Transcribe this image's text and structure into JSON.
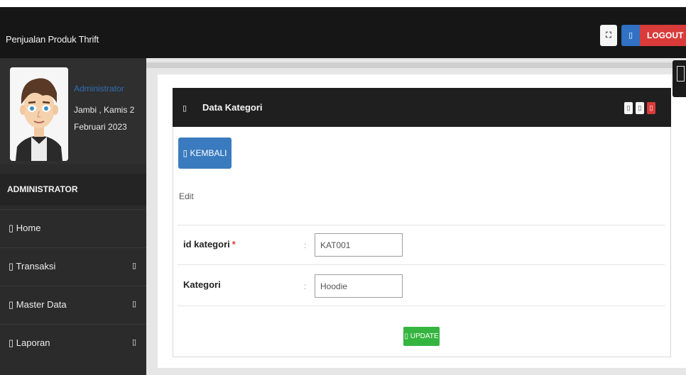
{
  "app": {
    "brand": "Penjualan Produk Thrift"
  },
  "topbar": {
    "fullscreen_icon": "expand-icon",
    "fullscreen_glyph": "⛶",
    "logout_icon": "power-icon",
    "logout_glyph": "▯",
    "logout_label": "LOGOUT"
  },
  "user": {
    "name": "Administrator",
    "date": "Jambi , Kamis 2 Februari 2023",
    "avatar": "avatar-illustration"
  },
  "sidebar": {
    "header": "ADMINISTRATOR",
    "items": [
      {
        "icon_glyph": "▯",
        "label": "Home",
        "caret": ""
      },
      {
        "icon_glyph": "▯",
        "label": "Transaksi",
        "caret": "▯"
      },
      {
        "icon_glyph": "▯",
        "label": "Master Data",
        "caret": "▯"
      },
      {
        "icon_glyph": "▯",
        "label": "Laporan",
        "caret": "▯"
      }
    ]
  },
  "panel": {
    "icon_glyph": "▯",
    "title": "Data Kategori",
    "tools": [
      "▯",
      "▯",
      "▯"
    ],
    "back_label": "▯ KEMBALI",
    "section_label": "Edit",
    "fields": [
      {
        "label": "id kategori",
        "required": "*",
        "colon": ":",
        "value": "KAT001"
      },
      {
        "label": "Kategori",
        "required": "",
        "colon": ":",
        "value": "Hoodie"
      }
    ],
    "submit_label": "▯ UPDATE"
  },
  "colors": {
    "navbar": "#161616",
    "sidebar": "#2b2b2b",
    "primary": "#3a7bbf",
    "danger": "#d93b3b",
    "success": "#35b53f",
    "link": "#2f6fb5"
  }
}
